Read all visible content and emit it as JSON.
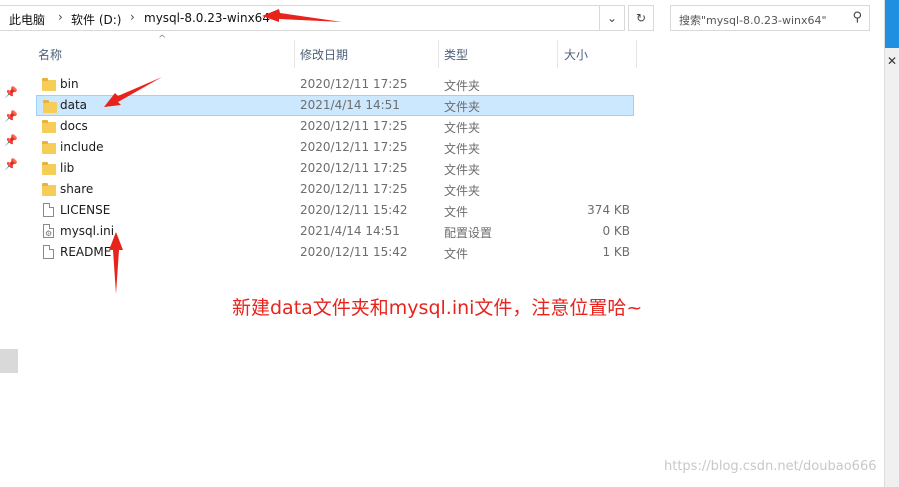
{
  "breadcrumb": {
    "items": [
      "此电脑",
      "软件 (D:)",
      "mysql-8.0.23-winx64"
    ],
    "separator": "›"
  },
  "address_controls": {
    "dropdown_icon": "chevron-down-icon",
    "refresh_icon": "refresh-icon"
  },
  "search": {
    "placeholder": "搜索\"mysql-8.0.23-winx64\"",
    "icon": "search-icon"
  },
  "columns": {
    "name": "名称",
    "modified": "修改日期",
    "type": "类型",
    "size": "大小"
  },
  "files": [
    {
      "name": "bin",
      "modified": "2020/12/11 17:25",
      "type": "文件夹",
      "size": "",
      "kind": "folder",
      "selected": false
    },
    {
      "name": "data",
      "modified": "2021/4/14 14:51",
      "type": "文件夹",
      "size": "",
      "kind": "folder",
      "selected": true
    },
    {
      "name": "docs",
      "modified": "2020/12/11 17:25",
      "type": "文件夹",
      "size": "",
      "kind": "folder",
      "selected": false
    },
    {
      "name": "include",
      "modified": "2020/12/11 17:25",
      "type": "文件夹",
      "size": "",
      "kind": "folder",
      "selected": false
    },
    {
      "name": "lib",
      "modified": "2020/12/11 17:25",
      "type": "文件夹",
      "size": "",
      "kind": "folder",
      "selected": false
    },
    {
      "name": "share",
      "modified": "2020/12/11 17:25",
      "type": "文件夹",
      "size": "",
      "kind": "folder",
      "selected": false
    },
    {
      "name": "LICENSE",
      "modified": "2020/12/11 15:42",
      "type": "文件",
      "size": "374 KB",
      "kind": "file",
      "selected": false
    },
    {
      "name": "mysql.ini",
      "modified": "2021/4/14 14:51",
      "type": "配置设置",
      "size": "0 KB",
      "kind": "config",
      "selected": false
    },
    {
      "name": "README",
      "modified": "2020/12/11 15:42",
      "type": "文件",
      "size": "1 KB",
      "kind": "file",
      "selected": false
    }
  ],
  "annotation": {
    "text": "新建data文件夹和mysql.ini文件，注意位置哈~",
    "color": "#e8231c"
  },
  "watermark": "https://blog.csdn.net/doubao666",
  "colors": {
    "selection_bg": "#cce8ff",
    "selection_border": "#99d1ff",
    "folder": "#f6cd57",
    "header_text": "#4c607a",
    "accent_strip": "#1f8fe0"
  }
}
